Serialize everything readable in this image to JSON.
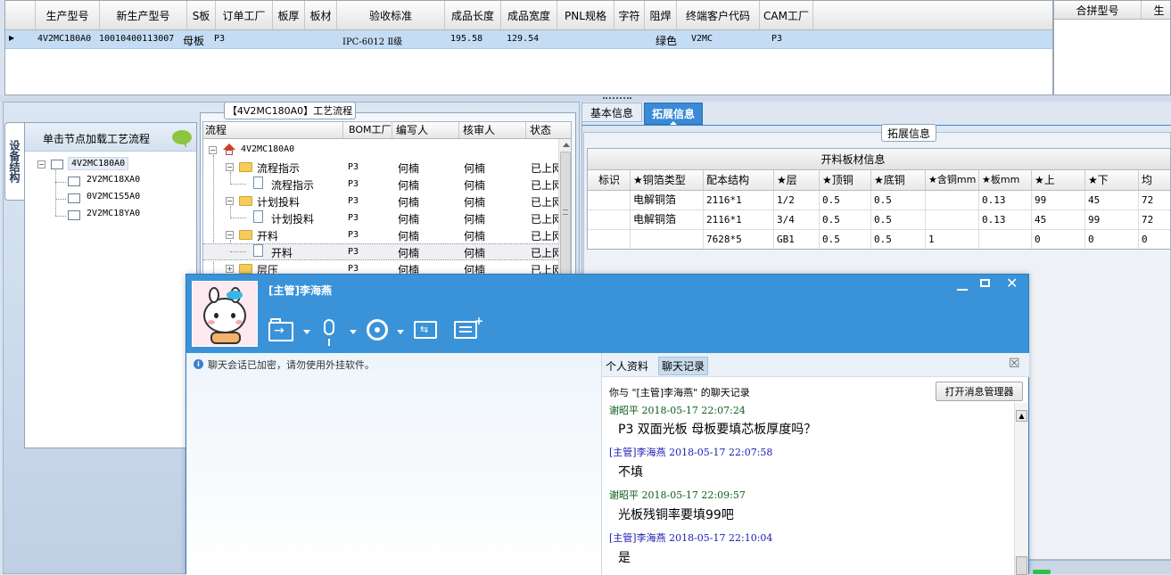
{
  "top_grid": {
    "headers": [
      "生产型号",
      "新生产型号",
      "S板",
      "订单工厂",
      "板厚",
      "板材",
      "验收标准",
      "成品长度",
      "成品宽度",
      "PNL规格",
      "字符",
      "阻焊",
      "终端客户代码",
      "CAM工厂"
    ],
    "row": [
      "4V2MC180A0",
      "10010400113007",
      "母板",
      "P3",
      "",
      "",
      "IPC-6012 Ⅱ级",
      "195.58",
      "129.54",
      "",
      "",
      "绿色",
      "V2MC",
      "P3"
    ]
  },
  "right_panel": {
    "header": "合拼型号",
    "header2": "生"
  },
  "flow_tab": {
    "title": "【4V2MC180A0】工艺流程"
  },
  "side_tab": {
    "label": "设备结构"
  },
  "left_tree": {
    "hint": "单击节点加载工艺流程",
    "root": "4V2MC180A0",
    "children": [
      "2V2MC18XA0",
      "0V2MC1S5A0",
      "2V2MC18YA0"
    ]
  },
  "flow_grid": {
    "headers": [
      "流程",
      "BOM工厂",
      "编写人",
      "核审人",
      "状态"
    ],
    "root": "4V2MC180A0",
    "rows": [
      {
        "name": "流程指示",
        "factory": "P3",
        "writer": "何楠",
        "reviewer": "何楠",
        "status": "已上网"
      },
      {
        "name": "流程指示",
        "factory": "P3",
        "writer": "何楠",
        "reviewer": "何楠",
        "status": "已上网"
      },
      {
        "name": "计划投料",
        "factory": "P3",
        "writer": "何楠",
        "reviewer": "何楠",
        "status": "已上网"
      },
      {
        "name": "计划投料",
        "factory": "P3",
        "writer": "何楠",
        "reviewer": "何楠",
        "status": "已上网"
      },
      {
        "name": "开料",
        "factory": "P3",
        "writer": "何楠",
        "reviewer": "何楠",
        "status": "已上网"
      },
      {
        "name": "开料",
        "factory": "P3",
        "writer": "何楠",
        "reviewer": "何楠",
        "status": "已上网"
      },
      {
        "name": "层压",
        "factory": "P3",
        "writer": "何楠",
        "reviewer": "何楠",
        "status": "已上网"
      }
    ]
  },
  "info_tabs": {
    "basic": "基本信息",
    "extended": "拓展信息"
  },
  "ext_panel": {
    "group_label": "拓展信息",
    "table_title": "开料板材信息",
    "headers": [
      "标识",
      "★铜箔类型",
      "配本结构",
      "★层",
      "★顶铜",
      "★底铜",
      "★含铜mm",
      "★板mm",
      "★上",
      "★下",
      "均"
    ],
    "rows": [
      [
        "",
        "电解铜箔",
        "2116*1",
        "1/2",
        "0.5",
        "0.5",
        "",
        "0.13",
        "99",
        "45",
        "72"
      ],
      [
        "",
        "电解铜箔",
        "2116*1",
        "3/4",
        "0.5",
        "0.5",
        "",
        "0.13",
        "45",
        "99",
        "72"
      ],
      [
        "",
        "",
        "7628*5",
        "GB1",
        "0.5",
        "0.5",
        "1",
        "",
        "0",
        "0",
        "0"
      ]
    ]
  },
  "chat": {
    "title": "[主管]李海燕",
    "notice": "聊天会话已加密，请勿使用外挂软件。",
    "tabs": {
      "profile": "个人资料",
      "history": "聊天记录"
    },
    "history_title": "你与 \"[主管]李海燕\" 的聊天记录",
    "open_manager": "打开消息管理器",
    "messages": [
      {
        "sender": "谢昭平",
        "time": "2018-05-17 22:07:24",
        "text": "P3  双面光板 母板要填芯板厚度吗？"
      },
      {
        "sender": "[主管]李海燕",
        "time": "2018-05-17 22:07:58",
        "text": "不填"
      },
      {
        "sender": "谢昭平",
        "time": "2018-05-17 22:09:57",
        "text": "光板残铜率要填99吧"
      },
      {
        "sender": "[主管]李海燕",
        "time": "2018-05-17 22:10:04",
        "text": "是"
      }
    ],
    "colors": {
      "titlebar": "#3a93d8",
      "sender_blue": "#1b1bb4",
      "sender_green": "#0b5e1b"
    }
  }
}
